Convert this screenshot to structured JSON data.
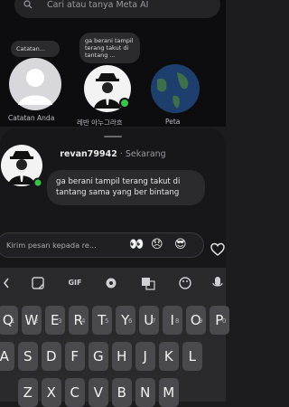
{
  "search": {
    "placeholder": "Cari atau tanya Meta AI"
  },
  "stories": [
    {
      "label": "Catatan Anda",
      "note": "Catatan..."
    },
    {
      "label": "레반 아누그라흐",
      "note": "ga berani tampil terang takut di tantang ..."
    },
    {
      "label": "Peta"
    }
  ],
  "chat": {
    "username": "revan79942",
    "separator": "·",
    "time": "Sekarang",
    "message": "ga berani tampil terang takut di tantang sama yang ber bintang"
  },
  "reply": {
    "placeholder": "Kirim pesan kepada re...",
    "emojis": [
      "👀",
      "😞",
      "😎"
    ]
  },
  "keyboard": {
    "toolbar": [
      "sticker-icon",
      "GIF",
      "settings-icon",
      "translate-icon",
      "palette-icon",
      "mic-icon"
    ],
    "gif_label": "GIF",
    "row1": [
      "Q",
      "W",
      "E",
      "R",
      "T",
      "Y",
      "U",
      "I",
      "O",
      "P"
    ],
    "row1_numbers": [
      "1",
      "2",
      "3",
      "4",
      "5",
      "6",
      "7",
      "8",
      "9",
      "0"
    ],
    "row2": [
      "A",
      "S",
      "D",
      "F",
      "G",
      "H",
      "J",
      "K",
      "L"
    ],
    "row3": [
      "Z",
      "X",
      "C",
      "V",
      "B",
      "N",
      "M"
    ]
  }
}
